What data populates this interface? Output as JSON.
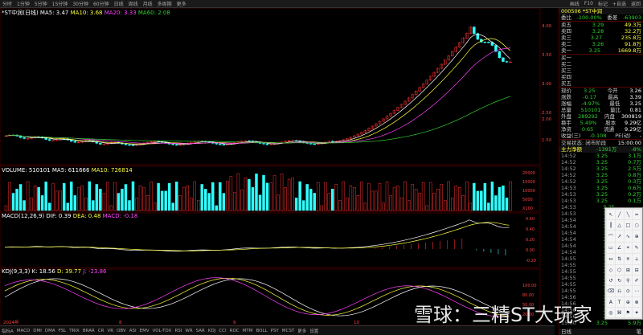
{
  "topbar": {
    "periods": [
      "分时",
      "1分钟",
      "5分钟",
      "15分钟",
      "30分钟",
      "60分钟",
      "日线",
      "周线",
      "月线",
      "多周期",
      "更多"
    ],
    "right_items": [
      "画线",
      "F10",
      "标记",
      "+自选",
      "返回"
    ]
  },
  "main_indicator": {
    "name": "*ST中润(日线)",
    "ma5": "MA5: 3.47",
    "ma10": "MA10: 3.68",
    "ma20": "MA20: 3.33",
    "ma60": "MA60: 2.08"
  },
  "price_axis": [
    "4.00",
    "3.50",
    "3.00",
    "2.50",
    "2.00",
    "1.50"
  ],
  "volume_indicator": {
    "name": "VOLUME: 510101",
    "ma5": "MA5: 611666",
    "ma10": "MA10: 726814"
  },
  "volume_axis": [
    "20000",
    "15000",
    "10000",
    "5000",
    "X100"
  ],
  "macd_indicator": {
    "name": "MACD(12,26,9)",
    "dif": "DIF: 0.39",
    "dea": "DEA: 0.48",
    "macd": "MACD: -0.18"
  },
  "macd_axis": [
    "0.60",
    "0.40",
    "0.20",
    "0.00",
    "-0.20"
  ],
  "kdj_indicator": {
    "name": "KDJ(9,3,3)",
    "k": "K: 18.56",
    "d": "D: 39.77",
    "j": "J: -23.86"
  },
  "kdj_axis": [
    "100.00",
    "80.00",
    "50.00",
    "20.00"
  ],
  "time_axis": [
    "2024年",
    "8",
    "9",
    "10"
  ],
  "bottombar": [
    "指标A",
    "MACD",
    "DMI",
    "DMA",
    "FSL",
    "TRIX",
    "BRAR",
    "CR",
    "VR",
    "OBV",
    "ASI",
    "EMV",
    "VOL-TDX",
    "RSI",
    "WR",
    "SAR",
    "KDJ",
    "CCI",
    "ROC",
    "MTM",
    "BOLL",
    "PSY",
    "MCST",
    "更多",
    "设置"
  ],
  "quote": {
    "code_name": "000506 *ST中润",
    "weibi_label": "委比",
    "weibi": "-100.00%",
    "weicha_label": "委差",
    "weicha": "-63903",
    "sell": [
      {
        "label": "卖五",
        "price": "3.29",
        "vol": "49.3万"
      },
      {
        "label": "卖四",
        "price": "3.28",
        "vol": "32.2万"
      },
      {
        "label": "卖三",
        "price": "3.27",
        "vol": "235.8万"
      },
      {
        "label": "卖二",
        "price": "3.26",
        "vol": "91.8万"
      },
      {
        "label": "卖一",
        "price": "3.25",
        "vol": "1669.8万"
      }
    ],
    "buy": [
      "买一",
      "买二",
      "买三",
      "买四",
      "买五"
    ],
    "stats": [
      {
        "l1": "现价",
        "v1": "3.25",
        "l2": "今开",
        "v2": "3.26"
      },
      {
        "l1": "涨跌",
        "v1": "-0.17",
        "l2": "最高",
        "v2": "3.39"
      },
      {
        "l1": "涨幅",
        "v1": "-4.97%",
        "l2": "最低",
        "v2": "3.25"
      },
      {
        "l1": "总量",
        "v1": "510101",
        "l2": "量比",
        "v2": "0.81"
      },
      {
        "l1": "外盘",
        "v1": "289292",
        "l2": "内盘",
        "v2": "300819"
      },
      {
        "l1": "换手",
        "v1": "5.49%",
        "l2": "股本",
        "v2": "9.29亿"
      },
      {
        "l1": "净资",
        "v1": "0.65",
        "l2": "流通",
        "v2": "9.29亿"
      },
      {
        "l1": "收益(三)",
        "v1": "-0.108",
        "l2": "PE(动)",
        "v2": "-"
      }
    ],
    "status": "交易状态: 闭市阶段",
    "status_time": "15:00:00",
    "net_label": "主力净额",
    "net_value": "-1391万",
    "net_pct": "-8%",
    "ticks": [
      {
        "t": "14:52",
        "p": "3.25",
        "v": "3.1万"
      },
      {
        "t": "14:52",
        "p": "3.25",
        "v": "0.7万"
      },
      {
        "t": "14:52",
        "p": "3.25",
        "v": "2.5万"
      },
      {
        "t": "14:52",
        "p": "3.25",
        "v": "0.8万"
      },
      {
        "t": "14:52",
        "p": "3.25",
        "v": "0.3万"
      },
      {
        "t": "14:53",
        "p": "3.25",
        "v": "0.6万"
      },
      {
        "t": "14:53",
        "p": "3.25",
        "v": "0.2万"
      },
      {
        "t": "14:53",
        "p": "3.25",
        "v": "0.1万"
      },
      {
        "t": "14:53",
        "p": "3.25",
        "v": ""
      },
      {
        "t": "14:53",
        "p": "3.25",
        "v": ""
      },
      {
        "t": "14:54",
        "p": "3.25",
        "v": ""
      },
      {
        "t": "14:54",
        "p": "3.25",
        "v": ""
      },
      {
        "t": "14:54",
        "p": "3.25",
        "v": ""
      },
      {
        "t": "14:54",
        "p": "3.25",
        "v": ""
      },
      {
        "t": "14:54",
        "p": "3.25",
        "v": ""
      },
      {
        "t": "14:54",
        "p": "3.25",
        "v": ""
      },
      {
        "t": "14:55",
        "p": "3.25",
        "v": ""
      },
      {
        "t": "14:55",
        "p": "3.25",
        "v": ""
      },
      {
        "t": "14:55",
        "p": "3.25",
        "v": ""
      },
      {
        "t": "14:55",
        "p": "3.25",
        "v": ""
      },
      {
        "t": "14:55",
        "p": "3.25",
        "v": ""
      },
      {
        "t": "14:55",
        "p": "3.25",
        "v": ""
      },
      {
        "t": "14:56",
        "p": "3.25",
        "v": ""
      },
      {
        "t": "14:56",
        "p": "3.25",
        "v": ""
      },
      {
        "t": "14:56",
        "p": "3.25",
        "v": ""
      },
      {
        "t": "14:56",
        "p": "3.25",
        "v": ""
      },
      {
        "t": "15:00",
        "p": "3.25",
        "v": "5.9万"
      }
    ],
    "bottom_tabs": [
      "日线",
      "笔"
    ]
  },
  "watermark": "雪球：三精ST大玩家",
  "colors": {
    "up": "#ff3030",
    "down": "#30ffff",
    "ma5": "#ffffff",
    "ma10": "#ffff40",
    "ma20": "#ff40ff",
    "ma60": "#30d030"
  }
}
